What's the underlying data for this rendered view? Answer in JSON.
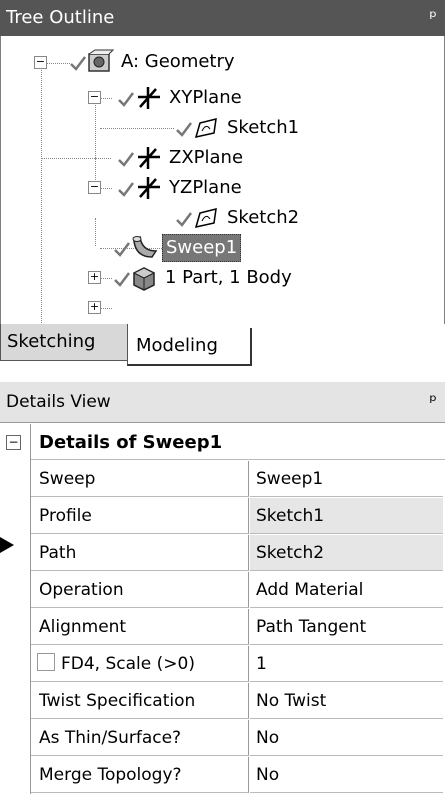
{
  "tree_outline": {
    "title": "Tree Outline",
    "pin_icon": "pushpin-icon",
    "nodes": [
      {
        "label": "A: Geometry",
        "icon": "geometry-icon",
        "expander": "−"
      },
      {
        "label": "XYPlane",
        "icon": "plane-axes-icon",
        "expander": "−"
      },
      {
        "label": "Sketch1",
        "icon": "sketch-icon"
      },
      {
        "label": "ZXPlane",
        "icon": "plane-axes-icon"
      },
      {
        "label": "YZPlane",
        "icon": "plane-axes-icon",
        "expander": "−"
      },
      {
        "label": "Sketch2",
        "icon": "sketch-icon"
      },
      {
        "label": "Sweep1",
        "icon": "sweep-icon",
        "expander": "+",
        "selected": true
      },
      {
        "label": "1 Part, 1 Body",
        "icon": "part-body-icon",
        "expander": "+"
      }
    ],
    "tabs": [
      {
        "label": "Sketching",
        "active": false
      },
      {
        "label": "Modeling",
        "active": true
      }
    ]
  },
  "details_view": {
    "title": "Details View",
    "group_title": "Details of Sweep1",
    "rows": [
      {
        "property": "Sweep",
        "value": "Sweep1"
      },
      {
        "property": "Profile",
        "value": "Sketch1"
      },
      {
        "property": "Path",
        "value": "Sketch2"
      },
      {
        "property": "Operation",
        "value": "Add Material"
      },
      {
        "property": "Alignment",
        "value": "Path Tangent"
      },
      {
        "property": "FD4,  Scale (>0)",
        "value": "1"
      },
      {
        "property": "Twist Specification",
        "value": "No Twist"
      },
      {
        "property": "As Thin/Surface?",
        "value": "No"
      },
      {
        "property": "Merge Topology?",
        "value": "No"
      }
    ]
  }
}
